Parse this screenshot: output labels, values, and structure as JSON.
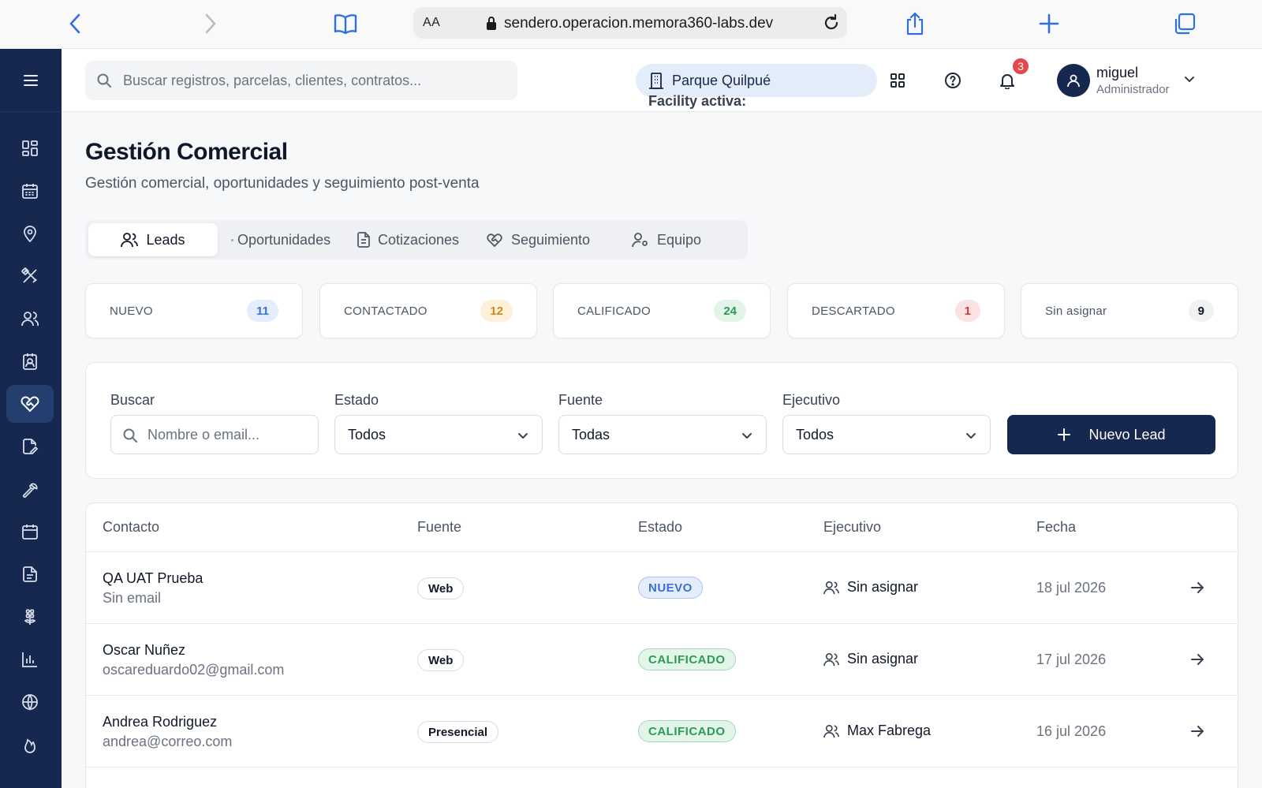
{
  "browser": {
    "aa_label": "AA",
    "url": "sendero.operacion.memora360-labs.dev"
  },
  "header": {
    "search_placeholder": "Buscar registros, parcelas, clientes, contratos...",
    "facility_label": "Facility activa:",
    "facility_name": "Parque Quilpué",
    "notification_count": "3",
    "user_name": "miguel",
    "user_role": "Administrador"
  },
  "page": {
    "title": "Gestión Comercial",
    "subtitle": "Gestión comercial, oportunidades y seguimiento post-venta"
  },
  "tabs": [
    {
      "label": "Leads",
      "icon": "users-icon",
      "active": true
    },
    {
      "label": "Oportunidades",
      "icon": "dot",
      "active": false
    },
    {
      "label": "Cotizaciones",
      "icon": "document-icon",
      "active": false
    },
    {
      "label": "Seguimiento",
      "icon": "heart-handshake-icon",
      "active": false
    },
    {
      "label": "Equipo",
      "icon": "user-gear-icon",
      "active": false
    }
  ],
  "stats": [
    {
      "label": "NUEVO",
      "count": "11",
      "color": "#3b6fd4",
      "bg": "#e3edfb"
    },
    {
      "label": "CONTACTADO",
      "count": "12",
      "color": "#d08a1a",
      "bg": "#fdf0d8"
    },
    {
      "label": "CALIFICADO",
      "count": "24",
      "color": "#2f9a57",
      "bg": "#e1f5e8"
    },
    {
      "label": "DESCARTADO",
      "count": "1",
      "color": "#d13b3b",
      "bg": "#fbe3e3"
    },
    {
      "label": "Sin asignar",
      "count": "9",
      "color": "#111827",
      "bg": "#f0f1f3"
    }
  ],
  "filters": {
    "search_label": "Buscar",
    "search_placeholder": "Nombre o email...",
    "estado_label": "Estado",
    "estado_value": "Todos",
    "fuente_label": "Fuente",
    "fuente_value": "Todas",
    "ejecutivo_label": "Ejecutivo",
    "ejecutivo_value": "Todos",
    "new_button": "Nuevo Lead"
  },
  "table": {
    "columns": [
      "Contacto",
      "Fuente",
      "Estado",
      "Ejecutivo",
      "Fecha"
    ],
    "rows": [
      {
        "name": "QA UAT Prueba",
        "email": "Sin email",
        "source": "Web",
        "status": "NUEVO",
        "executive": "Sin asignar",
        "date": "18 jul 2026"
      },
      {
        "name": "Oscar Nuñez",
        "email": "oscareduardo02@gmail.com",
        "source": "Web",
        "status": "CALIFICADO",
        "executive": "Sin asignar",
        "date": "17 jul 2026"
      },
      {
        "name": "Andrea Rodriguez",
        "email": "andrea@correo.com",
        "source": "Presencial",
        "status": "CALIFICADO",
        "executive": "Max Fabrega",
        "date": "16 jul 2026"
      }
    ]
  },
  "colors": {
    "sidebar": "#16284f",
    "primary": "#16284f",
    "nuevo_text": "#3b6fd4",
    "nuevo_bg": "#e3edfb",
    "calificado_text": "#2f9a57",
    "calificado_bg": "#e1f5e8"
  }
}
